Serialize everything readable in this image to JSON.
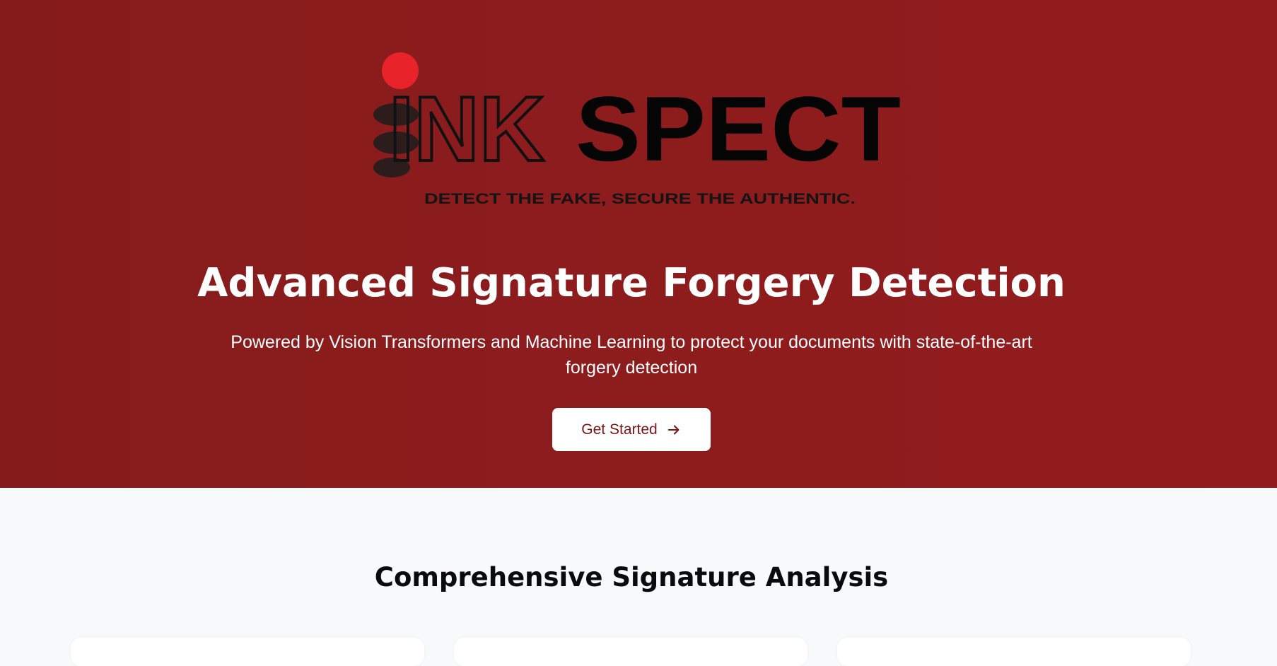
{
  "hero": {
    "logo": {
      "brand_prefix": "INK",
      "brand_suffix": "SPECT",
      "tagline": "DETECT THE FAKE, SECURE THE AUTHENTIC.",
      "dot_color": "#e8232a"
    },
    "title": "Advanced Signature Forgery Detection",
    "subtitle": "Powered by Vision Transformers and Machine Learning to protect your documents with state-of-the-art forgery detection",
    "cta_label": "Get Started",
    "cta_icon": "arrow-right-icon",
    "background_color": "#8b1c1d"
  },
  "features": {
    "title": "Comprehensive Signature Analysis",
    "cards": [
      {
        "label": "feature-card-1"
      },
      {
        "label": "feature-card-2"
      },
      {
        "label": "feature-card-3"
      }
    ]
  }
}
